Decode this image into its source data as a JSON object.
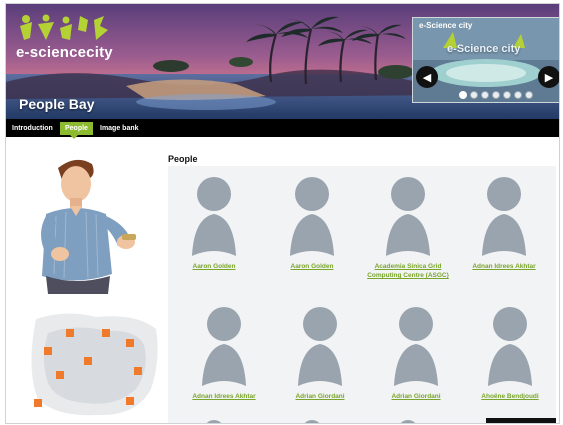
{
  "brand": {
    "name": "e-sciencecity"
  },
  "page_title": "People Bay",
  "carousel": {
    "title": "e-Science city",
    "brand": "e-Science city",
    "prev_icon": "chevron-left-icon",
    "next_icon": "chevron-right-icon",
    "dot_count": 7,
    "active_dot": 0
  },
  "tabs": [
    {
      "label": "Introduction"
    },
    {
      "label": "People"
    },
    {
      "label": "Image bank"
    }
  ],
  "section_title": "People",
  "people": [
    {
      "name": "Aaron Golden"
    },
    {
      "name": "Aaron Golden"
    },
    {
      "name": "Academia Sinica Grid Computing Centre (ASGC)"
    },
    {
      "name": "Adnan Idrees Akhtar"
    },
    {
      "name": "Adnan Idrees Akhtar"
    },
    {
      "name": "Adrian Giordani"
    },
    {
      "name": "Adrian Giordani"
    },
    {
      "name": "Ahoëne Bendjoudi"
    }
  ],
  "colors": {
    "accent_green": "#8dbb2f",
    "link_green": "#79a52a",
    "tabbar": "#000000",
    "silhouette": "#9aa4ae",
    "map_marker": "#f07a2c"
  }
}
